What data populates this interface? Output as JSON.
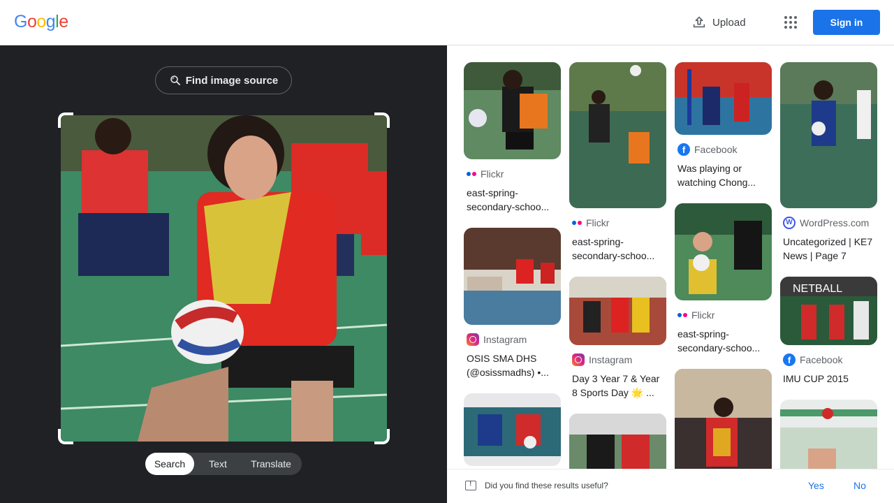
{
  "header": {
    "logo_letters": [
      {
        "ch": "G",
        "color": "#4285F4"
      },
      {
        "ch": "o",
        "color": "#EA4335"
      },
      {
        "ch": "o",
        "color": "#FBBC05"
      },
      {
        "ch": "g",
        "color": "#4285F4"
      },
      {
        "ch": "l",
        "color": "#34A853"
      },
      {
        "ch": "e",
        "color": "#EA4335"
      }
    ],
    "upload_label": "Upload",
    "signin_label": "Sign in"
  },
  "left": {
    "find_source_label": "Find image source",
    "modes": [
      "Search",
      "Text",
      "Translate"
    ],
    "active_mode": "Search"
  },
  "results": {
    "col1": [
      {
        "source": "Flickr",
        "source_icon": "flickr-icon",
        "title": "east-spring-secondary-schoo..."
      },
      {
        "source": "Instagram",
        "source_icon": "instagram-icon",
        "title": "OSIS SMA DHS (@osissmadhs) •..."
      },
      {
        "source": "",
        "source_icon": "",
        "title": ""
      }
    ],
    "col2": [
      {
        "source": "Flickr",
        "source_icon": "flickr-icon",
        "title": "east-spring-secondary-schoo..."
      },
      {
        "source": "Instagram",
        "source_icon": "instagram-icon",
        "title": "Day 3 Year 7 & Year 8 Sports Day 🌟 ..."
      },
      {
        "source": "",
        "source_icon": "",
        "title": ""
      }
    ],
    "col3": [
      {
        "source": "Facebook",
        "source_icon": "facebook-icon",
        "title": "Was playing or watching Chong..."
      },
      {
        "source": "Flickr",
        "source_icon": "flickr-icon",
        "title": "east-spring-secondary-schoo..."
      },
      {
        "source": "",
        "source_icon": "",
        "title": ""
      }
    ],
    "col4": [
      {
        "source": "WordPress.com",
        "source_icon": "wordpress-icon",
        "title": "Uncategorized | KE7 News | Page 7"
      },
      {
        "source": "Facebook",
        "source_icon": "facebook-icon",
        "title": "IMU CUP 2015",
        "thumb_text": "NETBALL"
      },
      {
        "source": "",
        "source_icon": "",
        "title": ""
      }
    ]
  },
  "feedback": {
    "question": "Did you find these results useful?",
    "yes": "Yes",
    "no": "No"
  },
  "colors": {
    "accent": "#1a73e8",
    "dark_pane": "#202124"
  }
}
